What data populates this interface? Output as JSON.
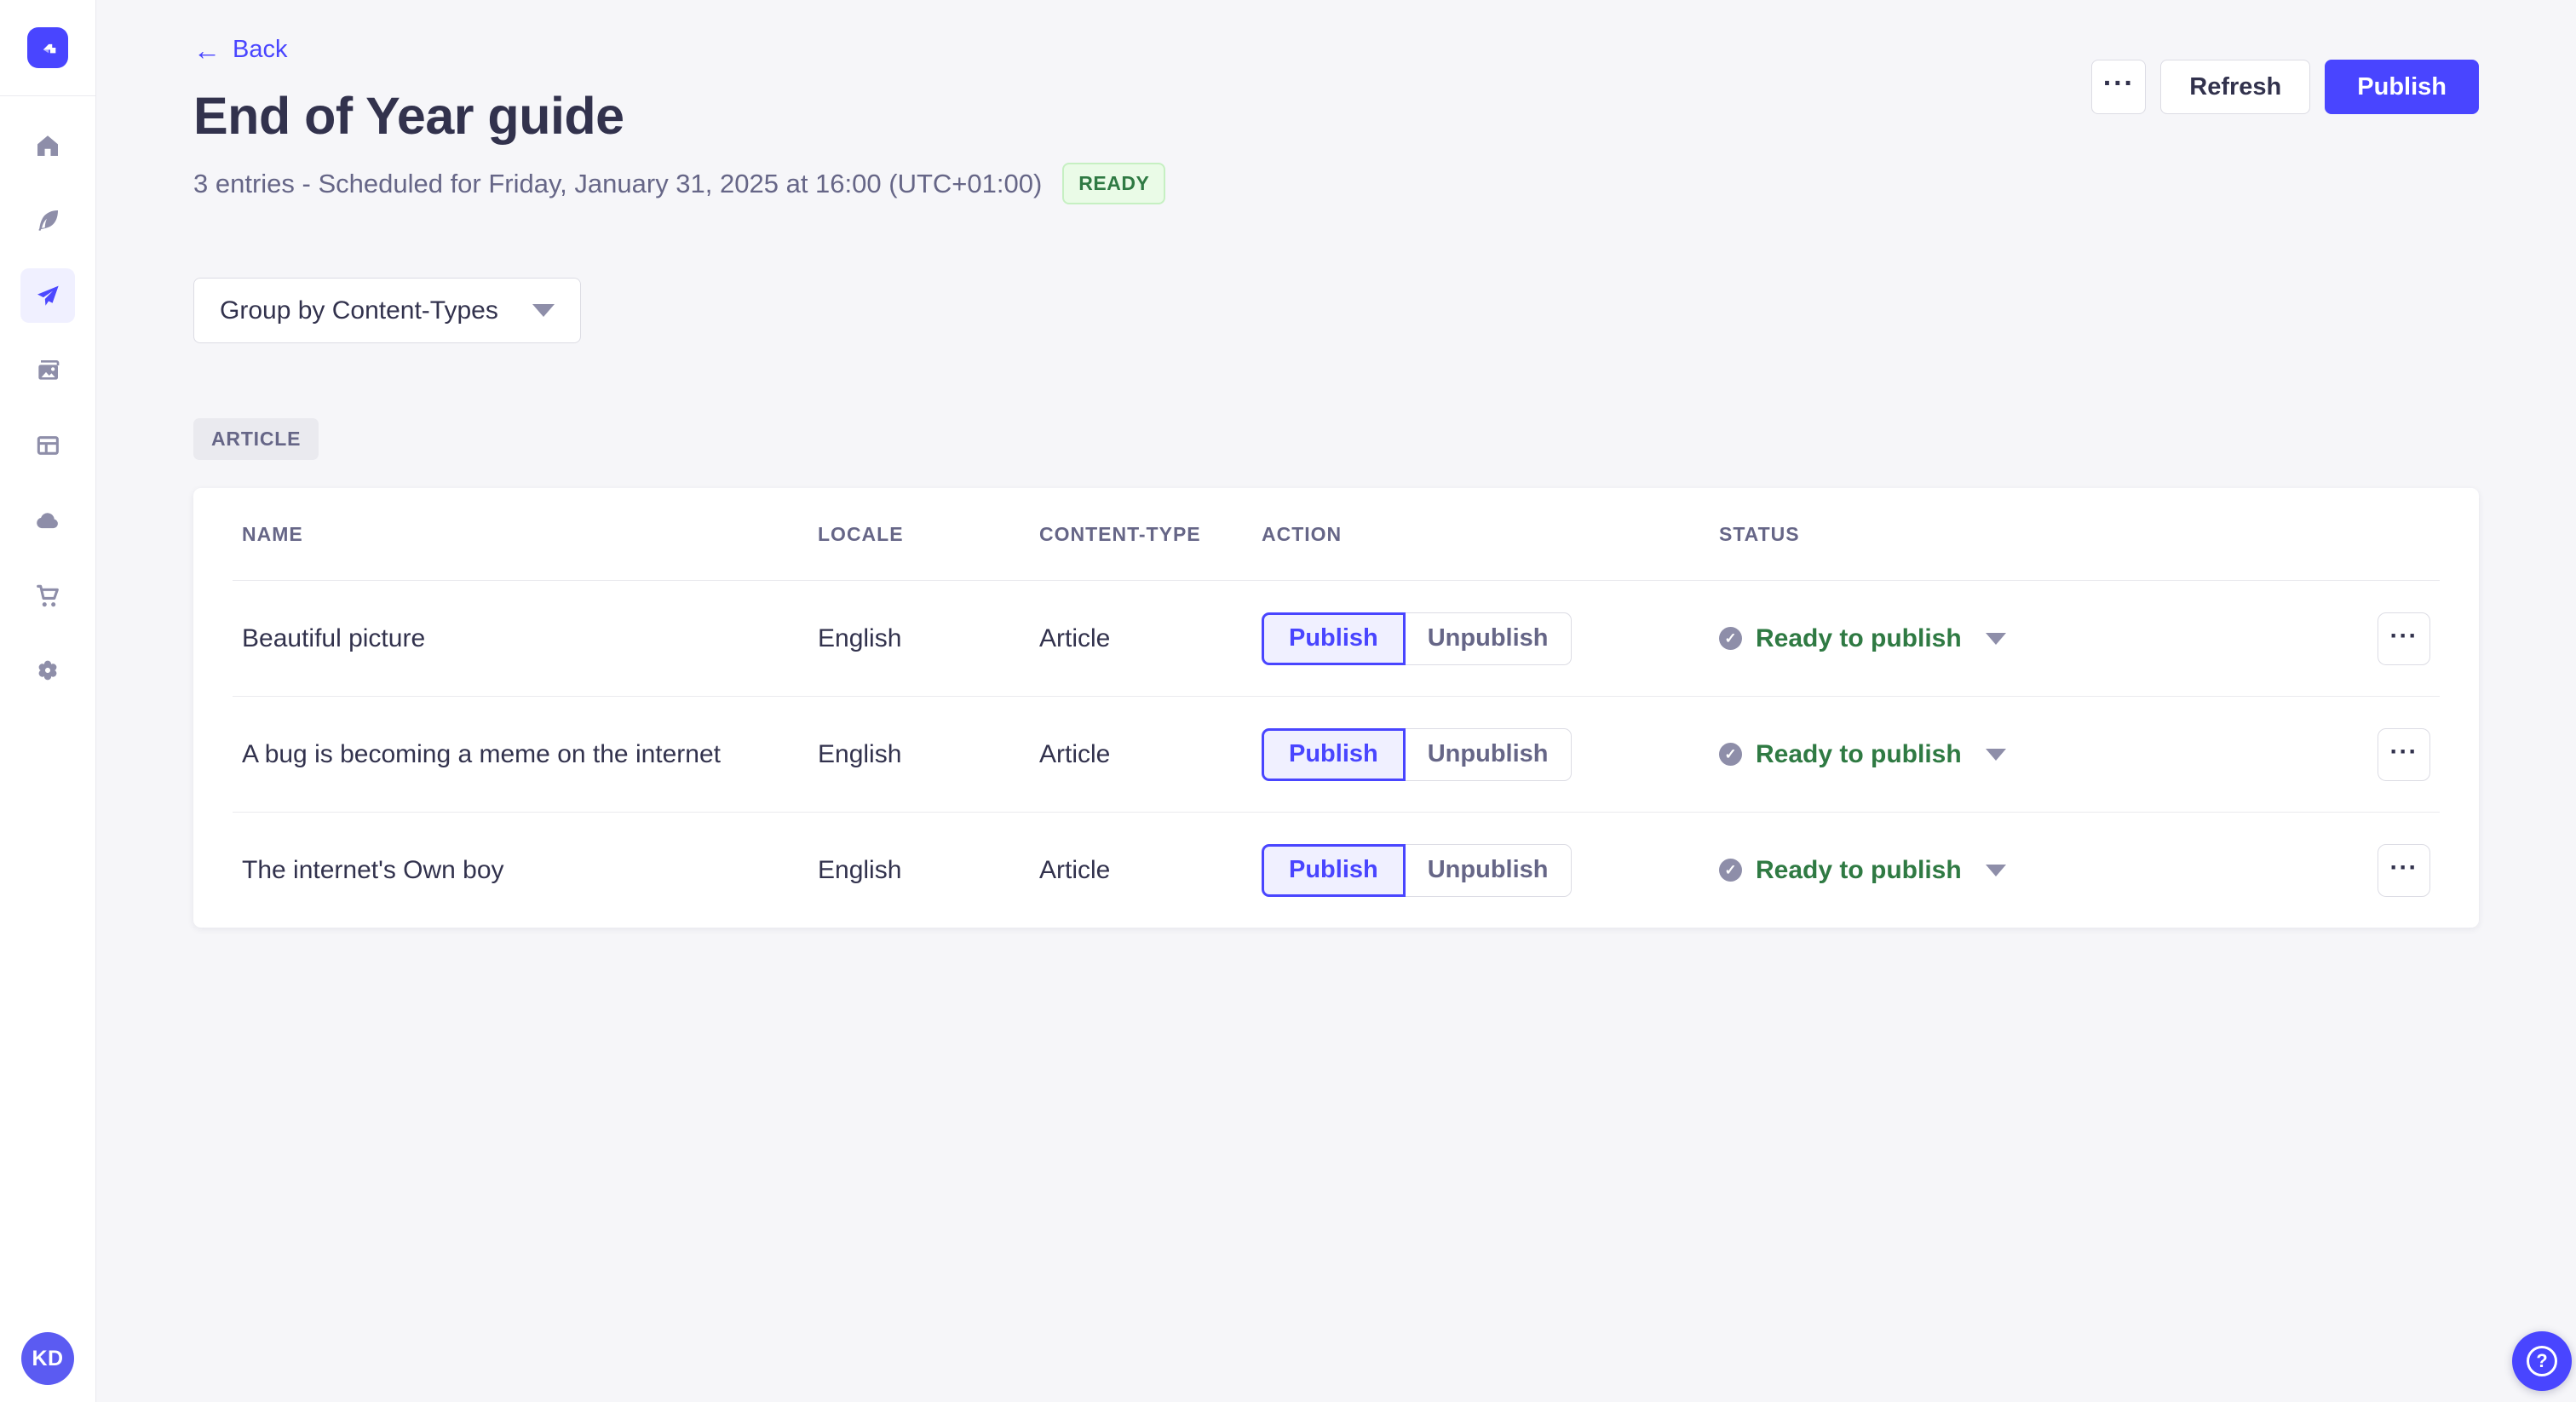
{
  "colors": {
    "accent": "#4945ff",
    "accent_light_bg": "#f0f0ff",
    "success_text": "#2f7a43",
    "success_bg": "#eafbe7",
    "success_border": "#c6f0c2",
    "neutral_text": "#32324d",
    "muted_text": "#666687",
    "border": "#dcdce4",
    "icon_gray": "#8e8ea9",
    "page_bg": "#f6f6f9"
  },
  "sidebar": {
    "nav_items": [
      {
        "id": "home",
        "icon": "home-icon",
        "active": false
      },
      {
        "id": "content-manager",
        "icon": "feather-icon",
        "active": false
      },
      {
        "id": "releases",
        "icon": "paper-plane-icon",
        "active": true
      },
      {
        "id": "media-library",
        "icon": "images-icon",
        "active": false
      },
      {
        "id": "content-type-builder",
        "icon": "layout-icon",
        "active": false
      },
      {
        "id": "deploy",
        "icon": "cloud-icon",
        "active": false
      },
      {
        "id": "marketplace",
        "icon": "cart-icon",
        "active": false
      },
      {
        "id": "settings",
        "icon": "gear-icon",
        "active": false
      }
    ],
    "avatar_initials": "KD"
  },
  "header": {
    "back_arrow": "←",
    "back_label": "Back",
    "title": "End of Year guide",
    "subtitle": "3 entries - Scheduled for Friday, January 31, 2025 at 16:00 (UTC+01:00)",
    "status_badge": "READY",
    "more_glyph": "···",
    "refresh_label": "Refresh",
    "publish_label": "Publish"
  },
  "toolbar": {
    "group_by_value": "Group by Content-Types"
  },
  "group": {
    "tag": "ARTICLE"
  },
  "table": {
    "headers": {
      "name": "NAME",
      "locale": "LOCALE",
      "content_type": "CONTENT-TYPE",
      "action": "ACTION",
      "status": "STATUS"
    },
    "action_buttons": {
      "publish": "Publish",
      "unpublish": "Unpublish"
    },
    "status_check_glyph": "✓",
    "row_more_glyph": "···",
    "rows": [
      {
        "name": "Beautiful picture",
        "locale": "English",
        "content_type": "Article",
        "status": "Ready to publish"
      },
      {
        "name": "A bug is becoming a meme on the internet",
        "locale": "English",
        "content_type": "Article",
        "status": "Ready to publish"
      },
      {
        "name": "The internet's Own boy",
        "locale": "English",
        "content_type": "Article",
        "status": "Ready to publish"
      }
    ]
  },
  "fab": {
    "help_glyph": "?"
  }
}
